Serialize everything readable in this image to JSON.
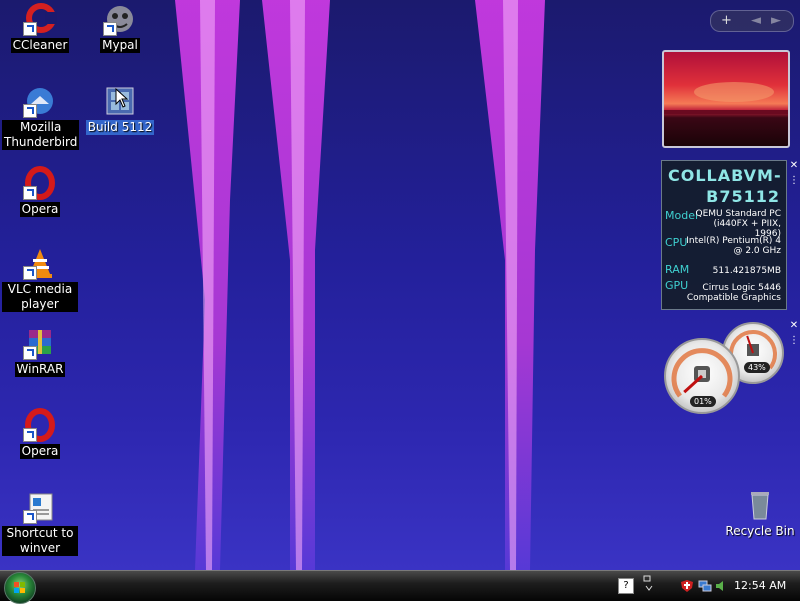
{
  "desktop": {
    "icons": [
      {
        "label": "CCleaner"
      },
      {
        "label": "Mypal"
      },
      {
        "label": "Mozilla Thunderbird"
      },
      {
        "label": "Build 5112"
      },
      {
        "label": "Opera"
      },
      {
        "label": "VLC media player"
      },
      {
        "label": "WinRAR"
      },
      {
        "label": "Opera"
      },
      {
        "label": "Shortcut to winver"
      },
      {
        "label": "Recycle Bin"
      }
    ]
  },
  "sidebar_control": {
    "add": "+",
    "prev": "◄",
    "next": "►"
  },
  "sysinfo": {
    "title": "COLLABVM-B75112",
    "rows": [
      {
        "key": "Model",
        "value": "QEMU Standard PC (i440FX + PIIX, 1996)"
      },
      {
        "key": "CPU",
        "value": "Intel(R) Pentium(R) 4 @ 2.0 GHz"
      },
      {
        "key": "RAM",
        "value": "511.421875MB"
      },
      {
        "key": "GPU",
        "value": "Cirrus Logic 5446 Compatible Graphics"
      }
    ]
  },
  "cpu_meter": {
    "cpu_readout": "01%",
    "mem_readout": "43%",
    "cpu_level": 0.01,
    "mem_level": 0.43
  },
  "gadget_tools": {
    "close": "✕"
  },
  "taskbar": {
    "clock": "12:54 AM"
  },
  "colors": {
    "beam": "#c030e0",
    "desktop": "#23209a"
  }
}
